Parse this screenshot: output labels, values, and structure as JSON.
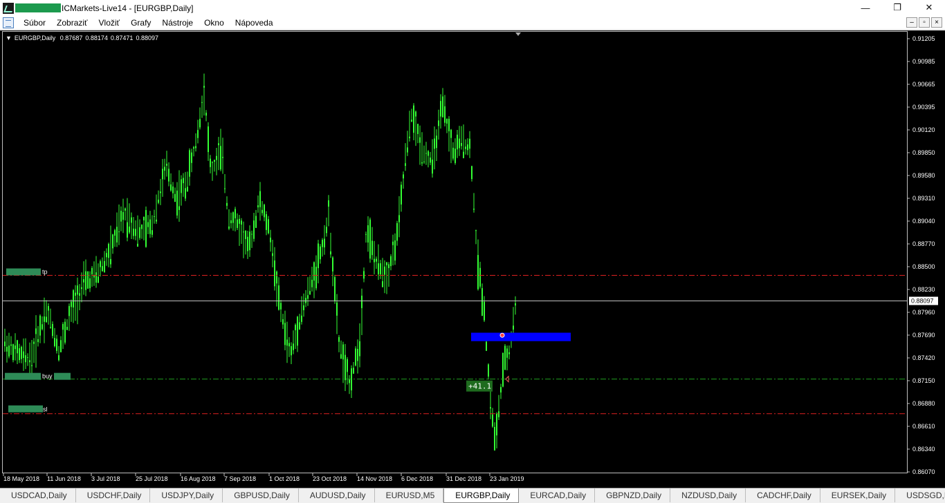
{
  "window": {
    "title": "ICMarkets-Live14 - [EURGBP,Daily]",
    "controls": {
      "minimize": "—",
      "maximize": "❐",
      "close": "✕"
    }
  },
  "menu": {
    "items": [
      "Súbor",
      "Zobraziť",
      "Vložiť",
      "Grafy",
      "Nástroje",
      "Okno",
      "Nápoveda"
    ],
    "mdi": {
      "minimize": "–",
      "restore": "▫",
      "close": "×"
    }
  },
  "chart": {
    "symbol_label": "EURGBP,Daily",
    "ohlc": [
      "0.87687",
      "0.88174",
      "0.87471",
      "0.88097"
    ],
    "current_price": "0.88097",
    "price_labels": [
      "0.91205",
      "0.90985",
      "0.90665",
      "0.90395",
      "0.90120",
      "0.89850",
      "0.89580",
      "0.89310",
      "0.89040",
      "0.88770",
      "0.88500",
      "0.88230",
      "0.87960",
      "0.87690",
      "0.87420",
      "0.87150",
      "0.86880",
      "0.86610",
      "0.86340",
      "0.86070"
    ],
    "date_labels": [
      "18 May 2018",
      "11 Jun 2018",
      "3 Jul 2018",
      "25 Jul 2018",
      "16 Aug 2018",
      "7 Sep 2018",
      "1 Oct 2018",
      "23 Oct 2018",
      "14 Nov 2018",
      "6 Dec 2018",
      "31 Dec 2018",
      "23 Jan 2019"
    ],
    "levels": {
      "tp": {
        "label": "tp",
        "price": 0.884,
        "color": "#e02020"
      },
      "buy": {
        "label": "buy",
        "price": 0.8717,
        "color": "#20a020"
      },
      "sl": {
        "label": "sl",
        "price": 0.8676,
        "color": "#e02020"
      }
    },
    "profit_label": "+41.1",
    "colors": {
      "candle": "#33ff33",
      "box": "#0000ff",
      "label_bg": "#2e8b57",
      "grid": "#c0c0c0"
    }
  },
  "tabs": {
    "items": [
      "USDCAD,Daily",
      "USDCHF,Daily",
      "USDJPY,Daily",
      "GBPUSD,Daily",
      "AUDUSD,Daily",
      "EURUSD,M5",
      "EURGBP,Daily",
      "EURCAD,Daily",
      "GBPNZD,Daily",
      "NZDUSD,Daily",
      "CADCHF,Daily",
      "EURSEK,Daily",
      "USDSGD,Daily"
    ],
    "active": "EURGBP,Daily"
  }
}
